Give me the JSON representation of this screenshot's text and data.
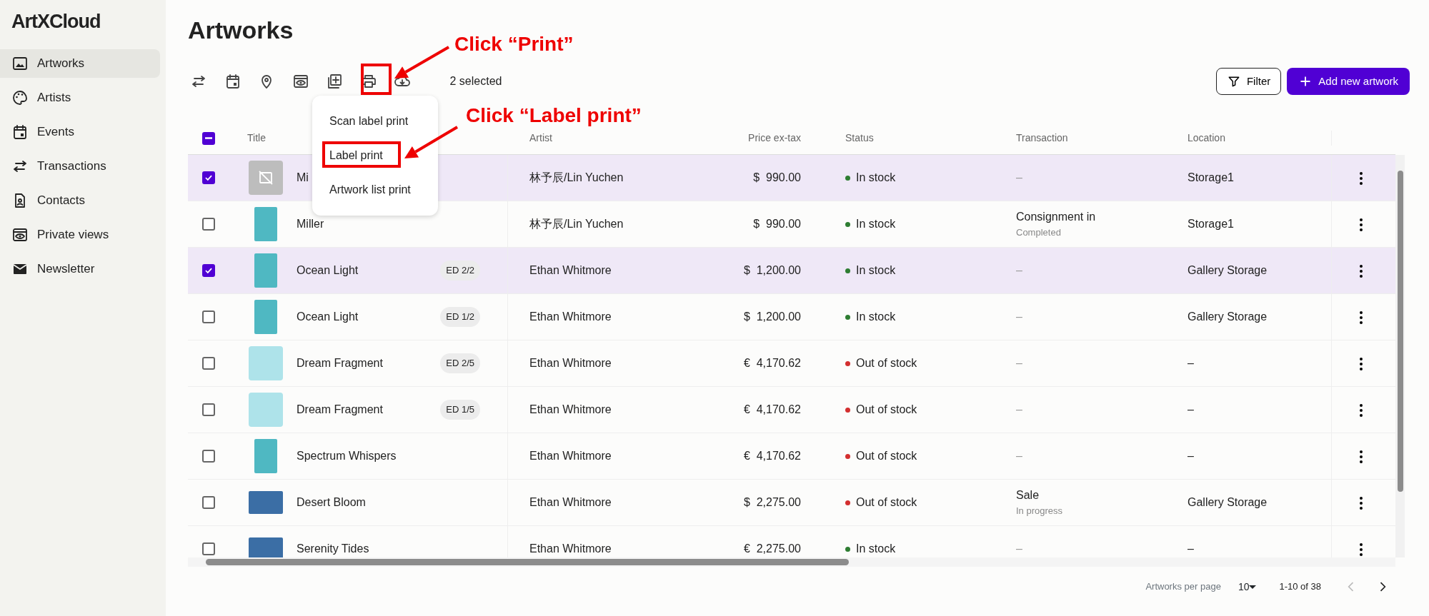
{
  "app": {
    "logo": "ArtXCloud"
  },
  "sidebar": {
    "items": [
      {
        "label": "Artworks",
        "selected": true
      },
      {
        "label": "Artists",
        "selected": false
      },
      {
        "label": "Events",
        "selected": false
      },
      {
        "label": "Transactions",
        "selected": false
      },
      {
        "label": "Contacts",
        "selected": false
      },
      {
        "label": "Private views",
        "selected": false
      },
      {
        "label": "Newsletter",
        "selected": false
      }
    ]
  },
  "page": {
    "title": "Artworks"
  },
  "toolbar": {
    "selection_count": "2 selected",
    "filter_button": "Filter",
    "add_button": "Add new artwork"
  },
  "print_menu": {
    "items": [
      "Scan label print",
      "Label print",
      "Artwork list print"
    ]
  },
  "table": {
    "select_all": {
      "indeterminate": true
    },
    "columns": [
      "Title",
      "Artist",
      "Price ex-tax",
      "Status",
      "Transaction",
      "Location"
    ],
    "rows": [
      {
        "selected": true,
        "kind": "placeholder",
        "title": "Mi",
        "edition": "",
        "artist": "林予辰/Lin Yuchen",
        "price": "$  990.00",
        "status": "In stock",
        "color": "#2e7d32",
        "transaction": "–",
        "transaction_status": "",
        "location": "Storage1"
      },
      {
        "selected": false,
        "kind": "portrait",
        "title": "Miller",
        "edition": "",
        "artist": "林予辰/Lin Yuchen",
        "price": "$  990.00",
        "status": "In stock",
        "color": "#2e7d32",
        "transaction": "Consignment in",
        "transaction_status": "Completed",
        "location": "Storage1"
      },
      {
        "selected": true,
        "kind": "portrait",
        "title": "Ocean Light",
        "edition": "ED 2/2",
        "artist": "Ethan Whitmore",
        "price": "$  1,200.00",
        "status": "In stock",
        "color": "#2e7d32",
        "transaction": "–",
        "transaction_status": "",
        "location": "Gallery Storage"
      },
      {
        "selected": false,
        "kind": "portrait",
        "title": "Ocean Light",
        "edition": "ED 1/2",
        "artist": "Ethan Whitmore",
        "price": "$  1,200.00",
        "status": "In stock",
        "color": "#2e7d32",
        "transaction": "–",
        "transaction_status": "",
        "location": "Gallery Storage"
      },
      {
        "selected": false,
        "kind": "square",
        "title": "Dream Fragment",
        "edition": "ED 2/5",
        "artist": "Ethan Whitmore",
        "price": "€  4,170.62",
        "status": "Out of stock",
        "color": "#d32f2f",
        "transaction": "–",
        "transaction_status": "",
        "location": "–"
      },
      {
        "selected": false,
        "kind": "square",
        "title": "Dream Fragment",
        "edition": "ED 1/5",
        "artist": "Ethan Whitmore",
        "price": "€  4,170.62",
        "status": "Out of stock",
        "color": "#d32f2f",
        "transaction": "–",
        "transaction_status": "",
        "location": "–"
      },
      {
        "selected": false,
        "kind": "portrait",
        "title": "Spectrum Whispers",
        "edition": "",
        "artist": "Ethan Whitmore",
        "price": "€  4,170.62",
        "status": "Out of stock",
        "color": "#d32f2f",
        "transaction": "–",
        "transaction_status": "",
        "location": "–"
      },
      {
        "selected": false,
        "kind": "landscape",
        "title": "Desert Bloom",
        "edition": "",
        "artist": "Ethan Whitmore",
        "price": "$  2,275.00",
        "status": "Out of stock",
        "color": "#d32f2f",
        "transaction": "Sale",
        "transaction_status": "In progress",
        "location": "Gallery Storage"
      },
      {
        "selected": false,
        "kind": "landscape",
        "title": "Serenity Tides",
        "edition": "",
        "artist": "Ethan Whitmore",
        "price": "€  2,275.00",
        "status": "In stock",
        "color": "#2e7d32",
        "transaction": "–",
        "transaction_status": "",
        "location": "–"
      }
    ]
  },
  "pagination": {
    "per_page_label": "Artworks per page",
    "per_page": "10",
    "range": "1-10 of 38",
    "previous_disabled": true,
    "next_disabled": false
  },
  "annotations": [
    {
      "kind": "arrow_box",
      "text": "Click “Print”"
    },
    {
      "kind": "arrow_box",
      "text": "Click “Label print”"
    }
  ]
}
